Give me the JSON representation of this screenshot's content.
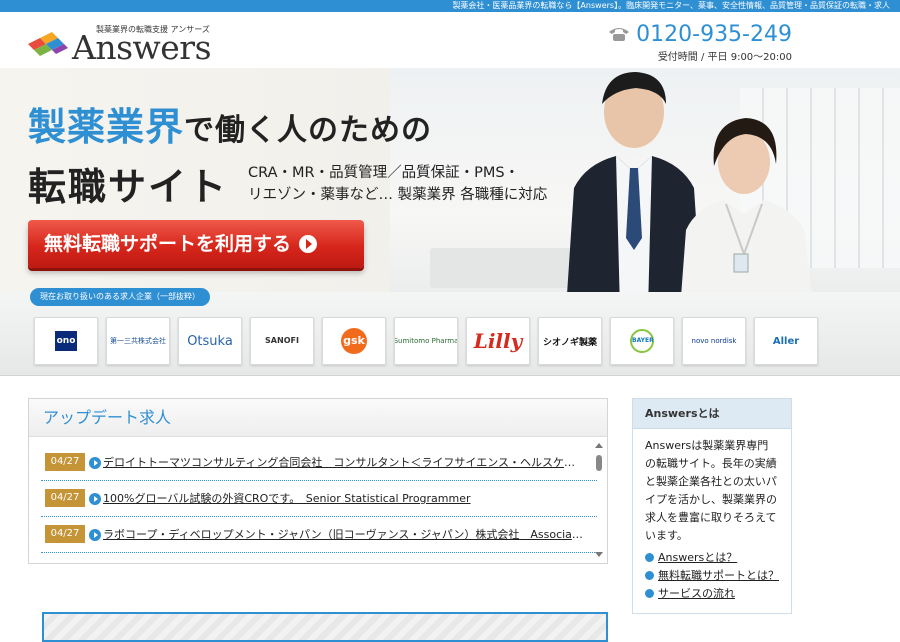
{
  "topbar": {
    "text": "製薬会社・医薬品業界の転職なら【Answers】。臨床開発モニター、薬事、安全性情報、品質管理・品質保証の転職・求人"
  },
  "header": {
    "tagline": "製薬業界の転職支援 アンサーズ",
    "logo_text": "Answers",
    "phone": "0120-935-249",
    "hours": "受付時間 / 平日 9:00〜20:00"
  },
  "hero": {
    "title_blue": "製薬業界",
    "title_rest": "で働く人のための",
    "title_line2": "転職サイト",
    "subtitle_line1": "CRA・MR・品質管理／品質保証・PMS・",
    "subtitle_line2": "リエゾン・薬事など… 製薬業界 各職種に対応",
    "cta_label": "無料転職サポートを利用する"
  },
  "companies": {
    "label": "現在お取り扱いのある求人企業（一部抜粋）",
    "logos": [
      {
        "name": "ono",
        "text": "ono"
      },
      {
        "name": "daiichi-sankyo",
        "text": "第一三共株式会社"
      },
      {
        "name": "otsuka",
        "text": "Otsuka"
      },
      {
        "name": "sanofi",
        "text": "SANOFI"
      },
      {
        "name": "gsk",
        "text": "gsk"
      },
      {
        "name": "sumitomo-pharma",
        "text": "Sumitomo Pharma"
      },
      {
        "name": "lilly",
        "text": "Lilly"
      },
      {
        "name": "shionogi",
        "text": "シオノギ製薬"
      },
      {
        "name": "bayer",
        "text": "BAYER"
      },
      {
        "name": "novo-nordisk",
        "text": "novo nordisk"
      },
      {
        "name": "allergan",
        "text": "Aller"
      }
    ]
  },
  "updates": {
    "title": "アップデート求人",
    "items": [
      {
        "date": "04/27",
        "text": "デロイトトーマツコンサルティング合同会社　コンサルタント＜ライフサイエンス・ヘルスケア領…"
      },
      {
        "date": "04/27",
        "text": "100%グローバル試験の外資CROです。　Senior Statistical Programmer"
      },
      {
        "date": "04/27",
        "text": "ラボコープ・ディベロップメント・ジャパン（旧コーヴァンス・ジャパン）株式会社　Associate Dire…"
      }
    ]
  },
  "about": {
    "title": "Answersとは",
    "body": "Answersは製薬業界専門の転職サイト。長年の実績と製薬企業各社との太いパイプを活かし、製薬業界の求人を豊富に取りそろえています。",
    "links": [
      "Answersとは？",
      "無料転職サポートとは？",
      "サービスの流れ"
    ]
  },
  "colors": {
    "brand_blue": "#2f8fd3",
    "cta_red": "#d7261c",
    "date_badge": "#c49436"
  }
}
